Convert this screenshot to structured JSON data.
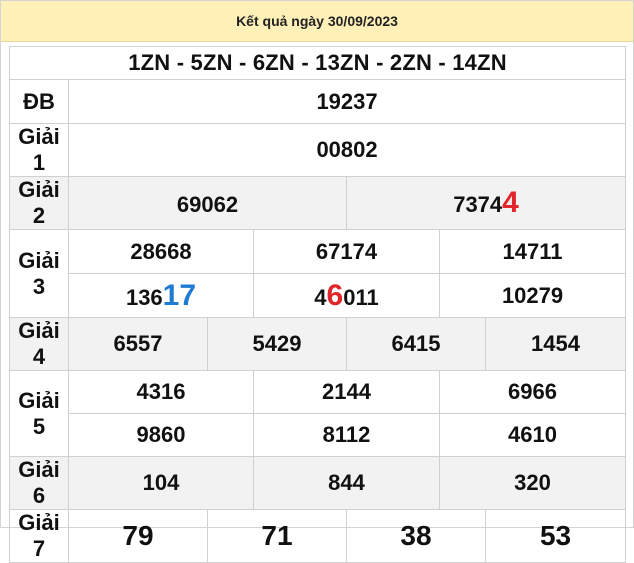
{
  "header": {
    "title": "Kết quả ngày 30/09/2023"
  },
  "codes": "1ZN - 5ZN - 6ZN - 13ZN - 2ZN - 14ZN",
  "colors": {
    "header_bg": "#fff0b8",
    "red": "#e0262b",
    "blue": "#1f7ad4",
    "codes": "#1b35b5"
  },
  "results": {
    "db": {
      "label": "ĐB",
      "value": "19237"
    },
    "g1": {
      "label": "Giải 1",
      "value": "00802"
    },
    "g2": {
      "label": "Giải 2",
      "values": [
        {
          "main": "69062",
          "tail": ""
        },
        {
          "main": "7374",
          "tail": "4"
        }
      ]
    },
    "g3": {
      "label": "Giải 3",
      "row1": [
        {
          "pre": "28668",
          "hl": "",
          "post": ""
        },
        {
          "pre": "67174",
          "hl": "",
          "post": ""
        },
        {
          "pre": "14711",
          "hl": "",
          "post": ""
        }
      ],
      "row2": [
        {
          "pre": "136",
          "hl": "17",
          "post": ""
        },
        {
          "pre": "4",
          "hl": "6",
          "post": "011"
        },
        {
          "pre": "10279",
          "hl": "",
          "post": ""
        }
      ]
    },
    "g4": {
      "label": "Giải 4",
      "values": [
        "6557",
        "5429",
        "6415",
        "1454"
      ]
    },
    "g5": {
      "label": "Giải 5",
      "row1": [
        "4316",
        "2144",
        "6966"
      ],
      "row2": [
        "9860",
        "8112",
        "4610"
      ]
    },
    "g6": {
      "label": "Giải 6",
      "values": [
        "104",
        "844",
        "320"
      ]
    },
    "g7": {
      "label": "Giải 7",
      "values": [
        "79",
        "71",
        "38",
        "53"
      ]
    }
  }
}
